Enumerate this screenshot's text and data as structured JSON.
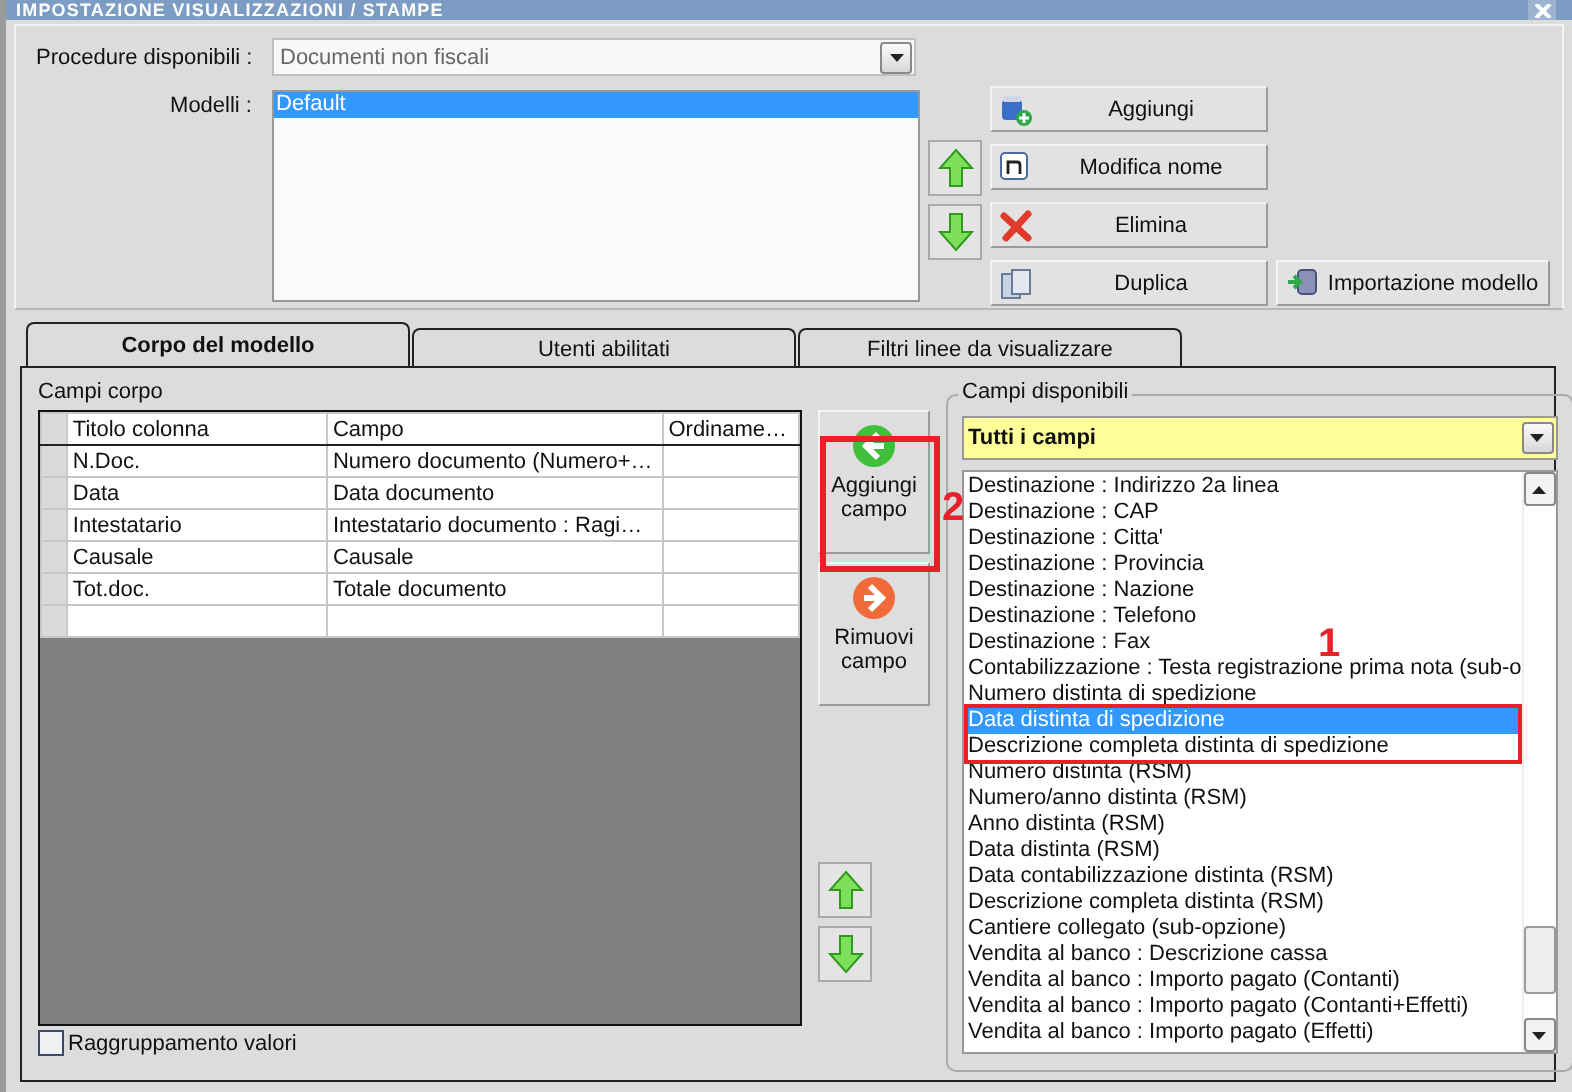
{
  "window": {
    "title": "IMPOSTAZIONE VISUALIZZAZIONI / STAMPE"
  },
  "procedure": {
    "label": "Procedure disponibili :",
    "value": "Documenti non fiscali"
  },
  "modelli": {
    "label": "Modelli :",
    "items": [
      {
        "label": "Default",
        "selected": true
      }
    ]
  },
  "model_buttons": [
    {
      "label": "Aggiungi",
      "kind": "add"
    },
    {
      "label": "Modifica nome",
      "kind": "rename"
    },
    {
      "label": "Elimina",
      "kind": "delete"
    },
    {
      "label": "Duplica",
      "kind": "duplicate"
    }
  ],
  "import_button": {
    "label": "Importazione modello"
  },
  "tabs": [
    {
      "label": "Corpo del modello",
      "selected": true
    },
    {
      "label": "Utenti abilitati",
      "selected": false
    },
    {
      "label": "Filtri linee da visualizzare",
      "selected": false
    }
  ],
  "body": {
    "title": "Campi corpo",
    "columns": [
      "Titolo colonna",
      "Campo",
      "Ordiname…"
    ],
    "rows": [
      [
        "N.Doc.",
        "Numero documento (Numero+…"
      ],
      [
        "Data",
        "Data documento"
      ],
      [
        "Intestatario",
        "Intestatario documento : Ragi…"
      ],
      [
        "Causale",
        "Causale"
      ],
      [
        "Tot.doc.",
        "Totale documento"
      ]
    ]
  },
  "add_field_button": {
    "label": "Aggiungi campo"
  },
  "remove_field_button": {
    "label": "Rimuovi campo"
  },
  "grouping": {
    "label": "Raggruppamento valori",
    "checked": false
  },
  "available": {
    "title": "Campi disponibili",
    "filter": "Tutti i campi",
    "items": [
      {
        "label": "Destinazione : Indirizzo 2a linea",
        "selected": false
      },
      {
        "label": "Destinazione : CAP",
        "selected": false
      },
      {
        "label": "Destinazione : Citta'",
        "selected": false
      },
      {
        "label": "Destinazione : Provincia",
        "selected": false
      },
      {
        "label": "Destinazione : Nazione",
        "selected": false
      },
      {
        "label": "Destinazione : Telefono",
        "selected": false
      },
      {
        "label": "Destinazione : Fax",
        "selected": false
      },
      {
        "label": "Contabilizzazione : Testa registrazione prima nota (sub-o",
        "selected": false
      },
      {
        "label": "Numero distinta di spedizione",
        "selected": false
      },
      {
        "label": "Data distinta di spedizione",
        "selected": true
      },
      {
        "label": "Descrizione completa distinta di spedizione",
        "selected": false
      },
      {
        "label": "Numero distinta (RSM)",
        "selected": false
      },
      {
        "label": "Numero/anno distinta (RSM)",
        "selected": false
      },
      {
        "label": "Anno distinta (RSM)",
        "selected": false
      },
      {
        "label": "Data distinta (RSM)",
        "selected": false
      },
      {
        "label": "Data contabilizzazione distinta (RSM)",
        "selected": false
      },
      {
        "label": "Descrizione completa distinta (RSM)",
        "selected": false
      },
      {
        "label": "Cantiere collegato (sub-opzione)",
        "selected": false
      },
      {
        "label": "Vendita al banco : Descrizione cassa",
        "selected": false
      },
      {
        "label": "Vendita al banco  : Importo pagato (Contanti)",
        "selected": false
      },
      {
        "label": "Vendita al banco : Importo pagato (Contanti+Effetti)",
        "selected": false
      },
      {
        "label": "Vendita al banco : Importo pagato (Effetti)",
        "selected": false
      }
    ]
  },
  "annotations": [
    {
      "label": "2"
    },
    {
      "label": "1"
    }
  ]
}
